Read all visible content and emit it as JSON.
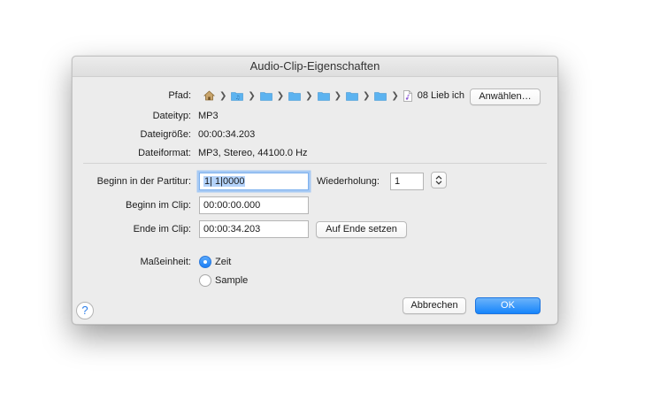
{
  "dialog": {
    "title": "Audio-Clip-Eigenschaften"
  },
  "info": {
    "path_label": "Pfad:",
    "path_tail": "08 Lieb ich",
    "choose_button": "Anwählen…",
    "type_label": "Dateityp:",
    "type_value": "MP3",
    "size_label": "Dateigröße:",
    "size_value": "00:00:34.203",
    "format_label": "Dateiformat:",
    "format_value": "MP3, Stereo, 44100.0 Hz"
  },
  "position": {
    "score_start_label": "Beginn in der Partitur:",
    "score_start_value": "1| 1|0000",
    "repeat_label": "Wiederholung:",
    "repeat_value": "1",
    "clip_start_label": "Beginn im Clip:",
    "clip_start_value": "00:00:00.000",
    "clip_end_label": "Ende im Clip:",
    "clip_end_value": "00:00:34.203",
    "set_end_button": "Auf Ende setzen"
  },
  "unit": {
    "label": "Maßeinheit:",
    "options": [
      "Zeit",
      "Sample"
    ],
    "selected": "Zeit"
  },
  "footer": {
    "help": "?",
    "cancel_button": "Abbrechen",
    "ok_button": "OK"
  },
  "colors": {
    "accent": "#1685fb",
    "folder": "#5cb3f0"
  }
}
